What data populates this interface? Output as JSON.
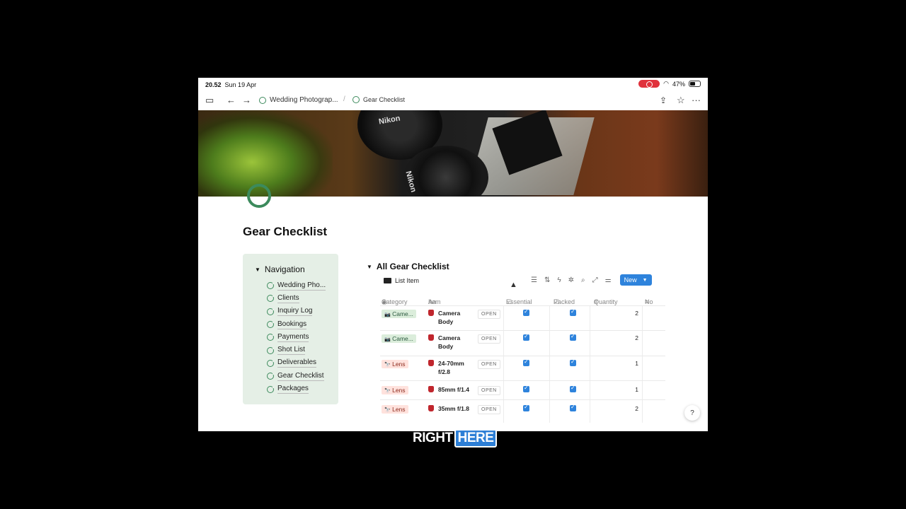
{
  "status": {
    "time": "20.52",
    "date": "Sun 19 Apr",
    "battery": "47%"
  },
  "breadcrumb": {
    "parent": "Wedding Photograp...",
    "current": "Gear Checklist"
  },
  "cover": {
    "brand1": "Nikon",
    "brand2": "Nikon"
  },
  "page": {
    "title": "Gear Checklist"
  },
  "navigation": {
    "heading": "Navigation",
    "items": [
      {
        "label": "Wedding Pho..."
      },
      {
        "label": "Clients"
      },
      {
        "label": "Inquiry Log"
      },
      {
        "label": "Bookings"
      },
      {
        "label": "Payments"
      },
      {
        "label": "Shot List"
      },
      {
        "label": "Deliverables"
      },
      {
        "label": "Gear Checklist"
      },
      {
        "label": "Packages"
      }
    ]
  },
  "database": {
    "title": "All Gear Checklist",
    "view": "List Item",
    "new_label": "New",
    "columns": {
      "category": "Category",
      "item": "Item",
      "essential": "Essential",
      "packed": "Packed",
      "quantity": "Quantity",
      "notes": "No"
    },
    "open_label": "OPEN",
    "rows": [
      {
        "category": "Came...",
        "cat_type": "camera",
        "cat_emoji": "📷",
        "item": "Camera Body",
        "essential": true,
        "packed": true,
        "quantity": "2"
      },
      {
        "category": "Came...",
        "cat_type": "camera",
        "cat_emoji": "📷",
        "item": "Camera Body",
        "essential": true,
        "packed": true,
        "quantity": "2"
      },
      {
        "category": "Lens",
        "cat_type": "lens",
        "cat_emoji": "🔭",
        "item": "24-70mm f/2.8",
        "essential": true,
        "packed": true,
        "quantity": "1"
      },
      {
        "category": "Lens",
        "cat_type": "lens",
        "cat_emoji": "🔭",
        "item": "85mm f/1.4",
        "essential": true,
        "packed": true,
        "quantity": "1"
      },
      {
        "category": "Lens",
        "cat_type": "lens",
        "cat_emoji": "🔭",
        "item": "35mm f/1.8",
        "essential": true,
        "packed": true,
        "quantity": "2"
      }
    ]
  },
  "caption": {
    "word1": "RIGHT",
    "word2": "HERE"
  },
  "colors": {
    "accent": "#2e83dc",
    "brand_green": "#3c8a5c",
    "callout_bg": "#e5efe6"
  }
}
